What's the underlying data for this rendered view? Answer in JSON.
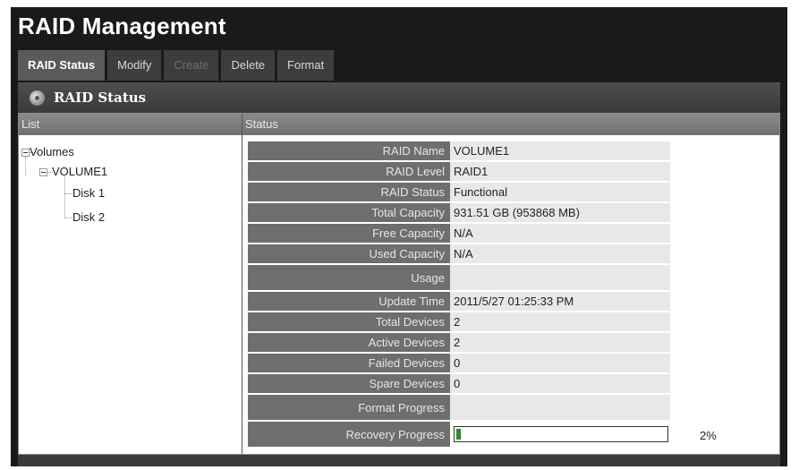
{
  "app": {
    "title": "RAID Management"
  },
  "tabs": [
    {
      "label": "RAID Status",
      "active": true
    },
    {
      "label": "Modify"
    },
    {
      "label": "Create",
      "disabled": true
    },
    {
      "label": "Delete"
    },
    {
      "label": "Format"
    }
  ],
  "section": {
    "title": "RAID Status"
  },
  "columns": {
    "list": "List",
    "status": "Status"
  },
  "tree": {
    "root": "Volumes",
    "volume": "VOLUME1",
    "disks": [
      "Disk 1",
      "Disk 2"
    ]
  },
  "status": {
    "rows": [
      {
        "label": "RAID Name",
        "value": "VOLUME1"
      },
      {
        "label": "RAID Level",
        "value": "RAID1"
      },
      {
        "label": "RAID Status",
        "value": "Functional"
      },
      {
        "label": "Total Capacity",
        "value": "931.51 GB (953868 MB)"
      },
      {
        "label": "Free Capacity",
        "value": "N/A"
      },
      {
        "label": "Used Capacity",
        "value": "N/A"
      },
      {
        "label": "Usage",
        "value": ""
      },
      {
        "label": "Update Time",
        "value": "2011/5/27 01:25:33 PM"
      },
      {
        "label": "Total Devices",
        "value": "2"
      },
      {
        "label": "Active Devices",
        "value": "2"
      },
      {
        "label": "Failed Devices",
        "value": "0"
      },
      {
        "label": "Spare Devices",
        "value": "0"
      },
      {
        "label": "Format Progress",
        "value": ""
      },
      {
        "label": "Recovery Progress",
        "value": "2%"
      }
    ],
    "recovery_progress_percent": 2
  },
  "colors": {
    "progress_fill": "#2d8a2d",
    "frame": "#1a1a1a",
    "key_cell": "#6e6e6e"
  }
}
